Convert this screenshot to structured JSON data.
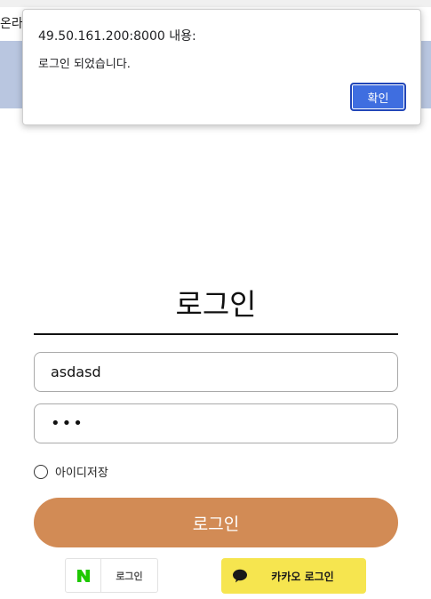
{
  "page": {
    "header_text": "온라인"
  },
  "alert": {
    "title": "49.50.161.200:8000 내용:",
    "message": "로그인 되었습니다.",
    "ok_label": "확인"
  },
  "login": {
    "title": "로그인",
    "username_value": "asdasd",
    "password_value": "•••",
    "remember_label": "아이디저장",
    "submit_label": "로그인"
  },
  "social": {
    "naver_logo": "N",
    "naver_label": "로그인",
    "kakao_label": "카카오 로그인",
    "kakao_icon": "speech-bubble-icon",
    "naver_color": "#1ec800",
    "kakao_color": "#f6e54f"
  },
  "colors": {
    "header_band": "#b9c6e0",
    "login_button": "#d28b55",
    "alert_button": "#3f6ee0"
  }
}
